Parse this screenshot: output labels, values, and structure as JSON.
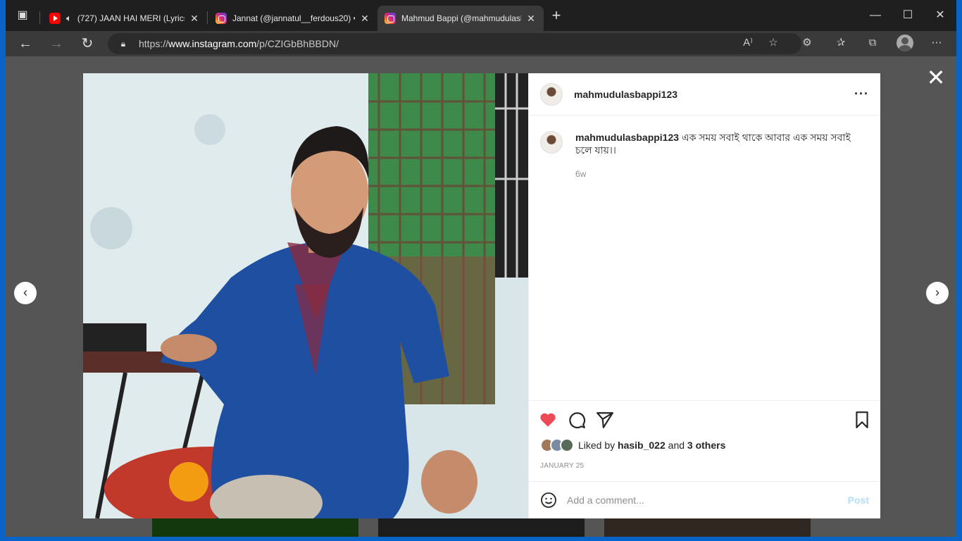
{
  "browser": {
    "tabs": [
      {
        "title": "(727) JAAN HAI MERI (Lyrics",
        "favicon": "youtube-icon",
        "audio": true
      },
      {
        "title": "Jannat (@jannatul__ferdous20) •",
        "favicon": "instagram-icon"
      },
      {
        "title": "Mahmud Bappi (@mahmudulasb",
        "favicon": "instagram-icon",
        "active": true
      }
    ],
    "url_prefix": "https://",
    "url_domain": "www.instagram.com",
    "url_path": "/p/CZIGbBhBBDN/"
  },
  "post": {
    "username": "mahmudulasbappi123",
    "caption_user": "mahmudulasbappi123",
    "caption_text": "এক সময় সবাই থাকে আবার এক সময় সবাই চলে যায়।।",
    "time_ago": "6w",
    "likes_prefix": "Liked by",
    "likes_user": "hasib_022",
    "likes_and": "and",
    "likes_others": "3 others",
    "date": "JANUARY 25",
    "comment_placeholder": "Add a comment...",
    "post_label": "Post",
    "liked": true
  },
  "colors": {
    "heart": "#ed4956",
    "post_button": "#b2dffc",
    "browser_dark": "#1f1f1f"
  }
}
